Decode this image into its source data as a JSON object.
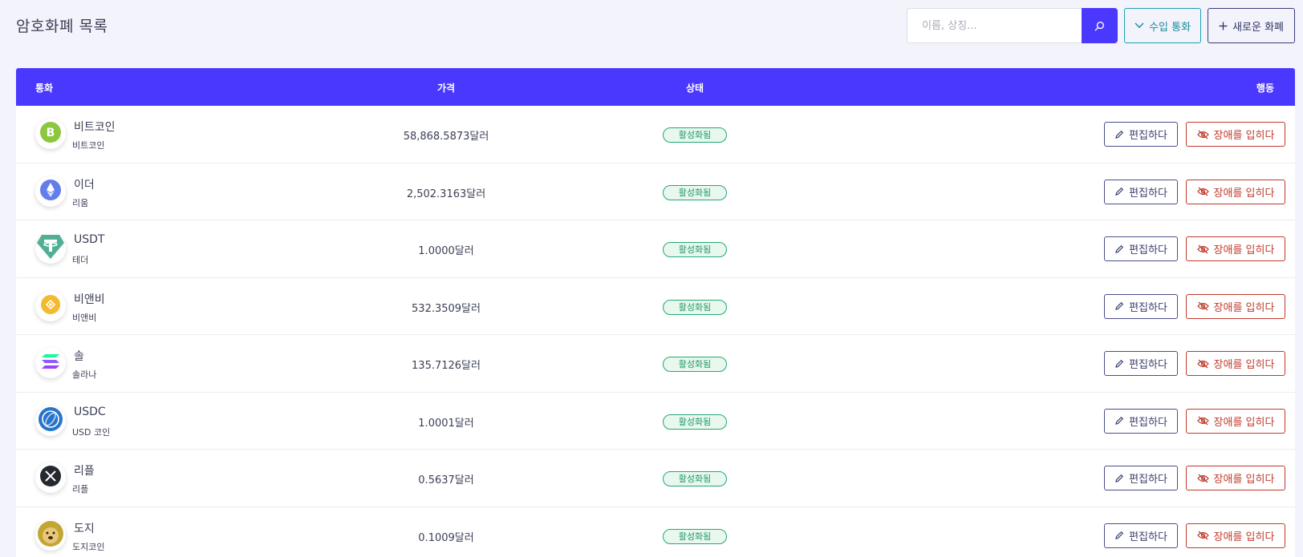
{
  "header": {
    "title": "암호화폐 목록",
    "search_placeholder": "이름, 상징...",
    "import_label": "수입 통화",
    "new_label": "새로운 화폐"
  },
  "table": {
    "headers": {
      "currency": "통화",
      "price": "가격",
      "status": "상태",
      "actions": "행동"
    },
    "edit_label": "편집하다",
    "disable_label": "장애를 입히다",
    "rows": [
      {
        "name": "비트코인",
        "sub": "비트코인",
        "price": "58,868.5873달러",
        "status": "활성화됨",
        "icon": "bitcoin-cash-icon",
        "color": "#8dc63f"
      },
      {
        "name": "이더",
        "sub": "리움",
        "price": "2,502.3163달러",
        "status": "활성화됨",
        "icon": "ethereum-icon",
        "color": "#627eea"
      },
      {
        "name": "USDT",
        "sub": "테더",
        "price": "1.0000달러",
        "status": "활성화됨",
        "icon": "tether-icon",
        "color": "#50af95"
      },
      {
        "name": "비앤비",
        "sub": "비앤비",
        "price": "532.3509달러",
        "status": "활성화됨",
        "icon": "bnb-icon",
        "color": "#f3ba2f"
      },
      {
        "name": "솔",
        "sub": "솔라나",
        "price": "135.7126달러",
        "status": "활성화됨",
        "icon": "solana-icon",
        "color": "#9945ff"
      },
      {
        "name": "USDC",
        "sub": "USD 코인",
        "price": "1.0001달러",
        "status": "활성화됨",
        "icon": "usdc-icon",
        "color": "#2775ca"
      },
      {
        "name": "리플",
        "sub": "리플",
        "price": "0.5637달러",
        "status": "활성화됨",
        "icon": "xrp-icon",
        "color": "#23292f"
      },
      {
        "name": "도지",
        "sub": "도지코인",
        "price": "0.1009달러",
        "status": "활성화됨",
        "icon": "dogecoin-icon",
        "color": "#c2a633"
      }
    ]
  },
  "colors": {
    "primary": "#4a38ff",
    "background": "#f3f3fb",
    "success": "#23a872",
    "danger": "#c0392b",
    "teal": "#1aa3b1"
  }
}
